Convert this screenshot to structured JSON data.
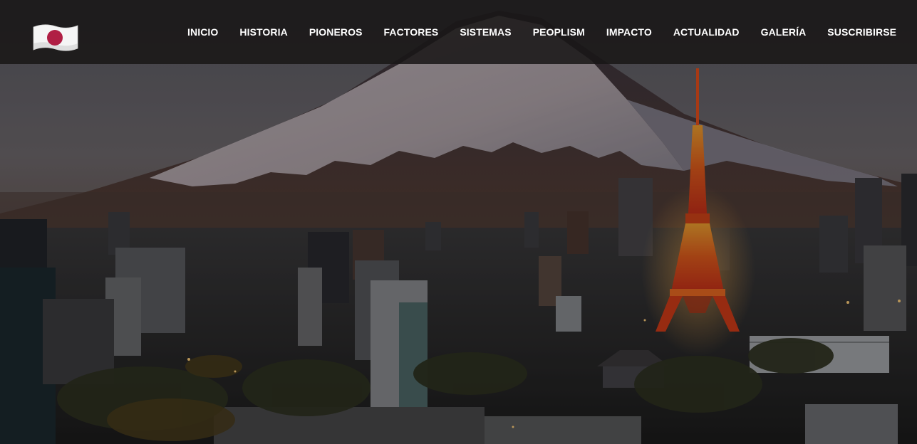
{
  "colors": {
    "nav_background": "#181616",
    "nav_text": "#ffffff",
    "flag_red": "#b01e44",
    "flag_white": "#f5f5f5",
    "tower_orange": "#e8501c"
  },
  "header": {
    "logo_icon": "japan-flag-icon",
    "nav_items": [
      {
        "label": "INICIO"
      },
      {
        "label": "HISTORIA"
      },
      {
        "label": "PIONEROS"
      },
      {
        "label": "FACTORES"
      },
      {
        "label": "SISTEMAS"
      },
      {
        "label": "PEOPLISM"
      },
      {
        "label": "IMPACTO"
      },
      {
        "label": "ACTUALIDAD"
      },
      {
        "label": "GALERÍA"
      },
      {
        "label": "SUSCRIBIRSE"
      }
    ]
  },
  "hero": {
    "image_icon": "mount-fuji-tokyo-skyline-image"
  }
}
